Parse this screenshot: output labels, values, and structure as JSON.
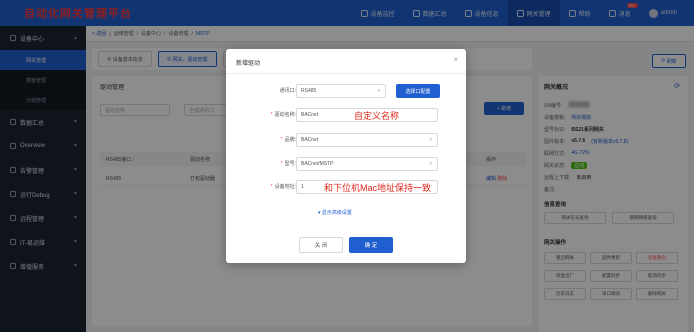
{
  "topbar": {
    "brand": "自动化网关管理平台",
    "nav": [
      {
        "label": "设备监控",
        "active": false
      },
      {
        "label": "数据汇总",
        "active": false
      },
      {
        "label": "设备信息",
        "active": false
      },
      {
        "label": "网关管理",
        "active": true
      },
      {
        "label": "帮助",
        "active": false
      },
      {
        "label": "消息",
        "active": false,
        "badge": "99+"
      },
      {
        "label": "admin",
        "active": false
      }
    ]
  },
  "sidebar": {
    "groups": [
      {
        "label": "设备中心"
      },
      {
        "label": "数据汇总"
      },
      {
        "label": "Overview"
      },
      {
        "label": "告警管理"
      },
      {
        "label": "运行Debug"
      },
      {
        "label": "远程管理"
      },
      {
        "label": "IT-易运维"
      },
      {
        "label": "增值服务"
      }
    ],
    "subitems": [
      {
        "label": "网关管理",
        "active": true
      },
      {
        "label": "模板管理",
        "active": false
      },
      {
        "label": "分组管理",
        "active": false
      }
    ]
  },
  "breadcrumb": [
    "返回",
    "运维管理",
    "设备中心",
    "设备管理",
    "MSTP"
  ],
  "tabs": [
    {
      "label": "设备基本信息",
      "active": false
    },
    {
      "label": "网关、驱动管理",
      "active": true
    },
    {
      "label": "",
      "active": false
    }
  ],
  "top_right_button": "刷新",
  "panel": {
    "title": "驱动管理",
    "filter1_placeholder": "驱动名称",
    "filter2_placeholder": "全部通讯口",
    "add_button": "+ 新增",
    "columns": [
      "RS485接口 ↑",
      "驱动名称",
      "操作"
    ],
    "rows": [
      {
        "port": "RS485",
        "driver": "打包驱动器",
        "edit": "编辑",
        "delete": "删除"
      }
    ]
  },
  "gateway": {
    "title": "网关概况",
    "kv": [
      {
        "k": "SN编号:",
        "v": "██████",
        "style": "blur"
      },
      {
        "k": "设备模板:",
        "v": "网关模板",
        "style": "blur"
      },
      {
        "k": "型号标识:",
        "v": "BS21系列网关",
        "style": "bold"
      },
      {
        "k": "固件版本:",
        "v": "v5.7.6",
        "extra": "(有新版本v5.7.8)",
        "style": "blue"
      },
      {
        "k": "联网方式:",
        "v": "4G 72%",
        "style": "blue"
      },
      {
        "k": "网关状态:",
        "v": "在线",
        "style": "tag"
      },
      {
        "k": "远程上下载:",
        "v": "未启用",
        "style": "plain"
      },
      {
        "k": "备注:",
        "v": "",
        "style": "plain"
      }
    ],
    "info_title": "信息查询",
    "info_buttons": [
      "网关信号查询",
      "联网网络查询"
    ],
    "ops_title": "网关操作",
    "op_buttons": [
      "重启网关",
      "固件更新",
      "设备重启",
      "恢复出厂",
      "配置同步",
      "取消同步",
      "历史日志",
      "串口调试",
      "删除网关"
    ]
  },
  "modal": {
    "title": "新增驱动",
    "close": "×",
    "fields": [
      {
        "label": "通讯口:",
        "value": "RS485",
        "required": false,
        "select": true
      },
      {
        "label": "驱动名称:",
        "value": "BACnet",
        "required": true,
        "select": false
      },
      {
        "label": "品牌:",
        "value": "BACnet",
        "required": true,
        "select": true
      },
      {
        "label": "型号:",
        "value": "BACnet/MSTP",
        "required": true,
        "select": true
      },
      {
        "label": "设备地址:",
        "value": "1",
        "required": true,
        "select": false
      }
    ],
    "choose_port_button": "选择口配置",
    "annotation_name": "自定义名称",
    "annotation_address": "和下位机Mac地址保持一致",
    "advanced_link": "▾ 显示高级设置",
    "cancel_button": "关 闭",
    "ok_button": "确 定"
  },
  "colors": {
    "primary": "#1f5fcf",
    "annotation": "#e0261d",
    "sidebar": "#1c2330"
  }
}
